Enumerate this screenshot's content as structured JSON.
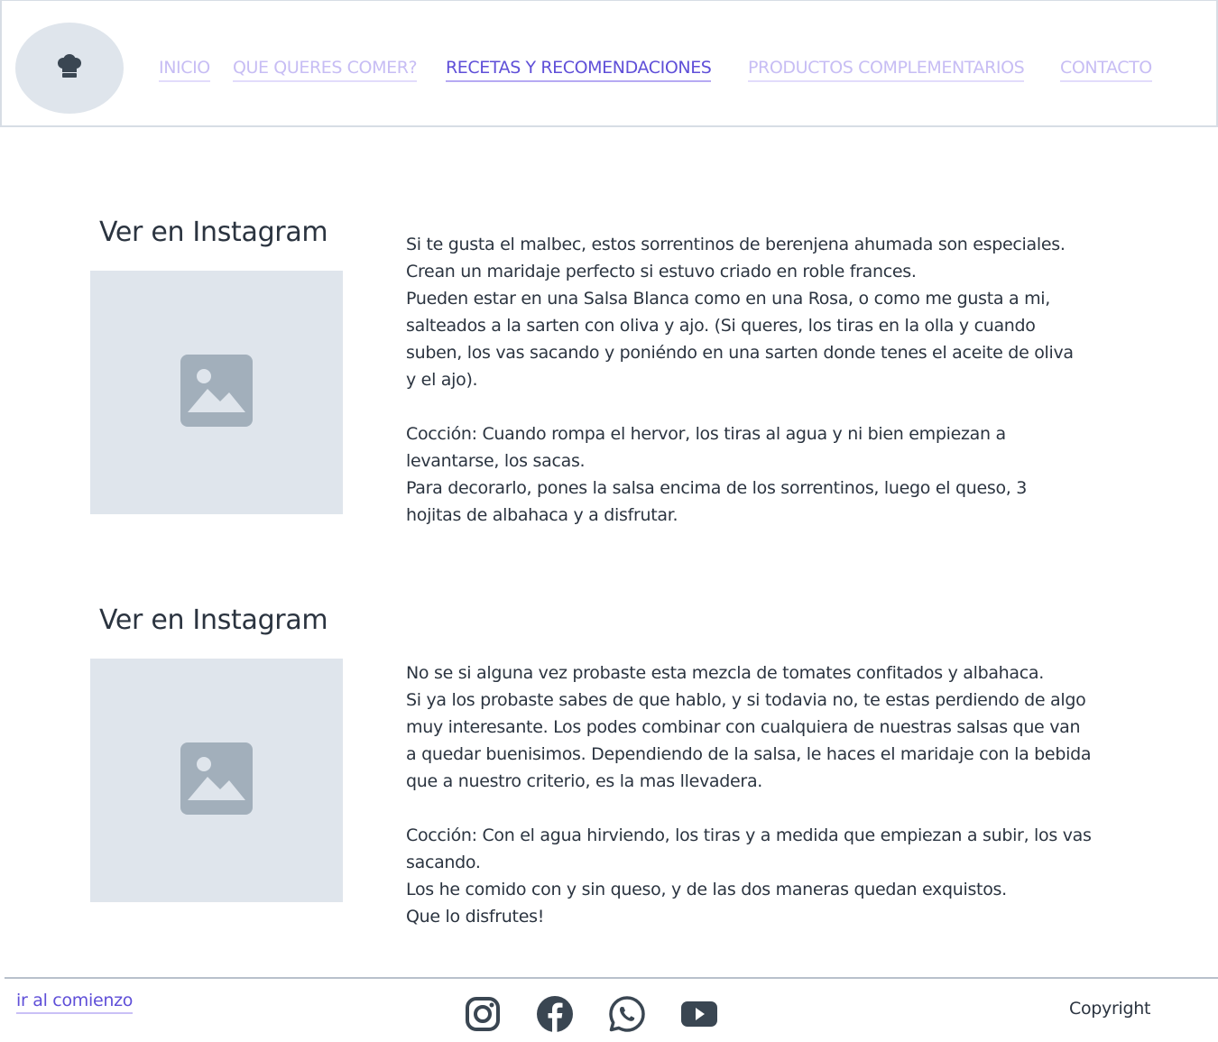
{
  "header": {
    "logo_icon": "chef-hat-icon",
    "nav": [
      {
        "label": "INICIO",
        "active": false
      },
      {
        "label": "QUE QUERES COMER?",
        "active": false
      },
      {
        "label": "RECETAS Y RECOMENDACIONES",
        "active": true
      },
      {
        "label": "PRODUCTOS COMPLEMENTARIOS",
        "active": false
      },
      {
        "label": "CONTACTO",
        "active": false
      }
    ]
  },
  "recipes": [
    {
      "title": "Ver en Instagram",
      "image_icon": "image-placeholder-icon",
      "text": " Si te gusta el malbec, estos sorrentinos de berenjena ahumada son especiales.\nCrean un maridaje perfecto si estuvo criado en roble frances.\n Pueden estar en una Salsa Blanca como en una Rosa, o como me gusta a mi,\nsalteados a la sarten con oliva y ajo. (Si queres, los tiras en la olla y cuando\nsuben, los vas sacando y poniéndo en una sarten donde tenes el aceite de oliva\ny el ajo).\n\nCocción: Cuando rompa el hervor, los tiras al agua y ni bien empiezan a\nlevantarse, los sacas.\n Para decorarlo, pones la salsa encima de los sorrentinos, luego el queso, 3\nhojitas de albahaca y a disfrutar."
    },
    {
      "title": "Ver en Instagram",
      "image_icon": "image-placeholder-icon",
      "text": " No se si alguna vez probaste esta mezcla de tomates confitados y albahaca.\n Si ya los probaste sabes de que hablo, y si todavia no, te estas perdiendo de algo\nmuy interesante. Los podes combinar con cualquiera de nuestras salsas que van\na quedar buenisimos. Dependiendo de la salsa, le haces el maridaje con la bebida\nque a nuestro criterio, es la mas llevadera.\n\n Cocción: Con el agua hirviendo, los tiras y a medida que empiezan a subir, los vas\nsacando.\n Los he comido con y sin queso, y de las dos maneras quedan exquistos.\n Que lo disfrutes!"
    }
  ],
  "footer": {
    "back_to_top": "ir al comienzo",
    "social": [
      "instagram-icon",
      "facebook-icon",
      "whatsapp-icon",
      "youtube-icon"
    ],
    "copyright": "Copyright"
  },
  "colors": {
    "nav_inactive": "#c7bdf4",
    "nav_active": "#5f4fd8",
    "placeholder_bg": "#dfe5ec",
    "placeholder_icon": "#a2afbb",
    "text": "#2b3440",
    "social_icon": "#3a4652"
  }
}
